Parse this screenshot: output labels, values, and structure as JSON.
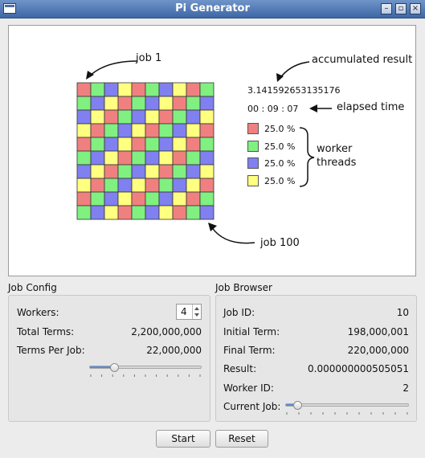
{
  "window": {
    "title": "Pi Generator",
    "controls": {
      "minimize": "–",
      "maximize": "▫",
      "close": "×"
    }
  },
  "visual": {
    "annotations": {
      "job1": "job 1",
      "job100": "job 100",
      "accumulated": "accumulated result",
      "elapsed": "elapsed time",
      "worker_threads_line1": "worker",
      "worker_threads_line2": "threads"
    },
    "result_value": "3.141592653135176",
    "elapsed_time": "00 : 09 : 07",
    "workers_legend": [
      {
        "color": "#f08080",
        "percent": "25.0 %"
      },
      {
        "color": "#80f080",
        "percent": "25.0 %"
      },
      {
        "color": "#8080f0",
        "percent": "25.0 %"
      },
      {
        "color": "#ffff80",
        "percent": "25.0 %"
      }
    ],
    "grid": {
      "rows": 10,
      "cols": 10,
      "colors": [
        "#f08080",
        "#80f080",
        "#8080f0",
        "#ffff80"
      ]
    }
  },
  "job_config": {
    "title": "Job Config",
    "workers_label": "Workers:",
    "workers_value": "4",
    "total_terms_label": "Total Terms:",
    "total_terms_value": "2,200,000,000",
    "terms_per_job_label": "Terms Per Job:",
    "terms_per_job_value": "22,000,000",
    "slider_fraction": 0.22
  },
  "job_browser": {
    "title": "Job Browser",
    "job_id_label": "Job ID:",
    "job_id_value": "10",
    "initial_term_label": "Initial Term:",
    "initial_term_value": "198,000,001",
    "final_term_label": "Final Term:",
    "final_term_value": "220,000,000",
    "result_label": "Result:",
    "result_value": "0.000000000505051",
    "worker_id_label": "Worker ID:",
    "worker_id_value": "2",
    "current_job_label": "Current Job:",
    "current_job_fraction": 0.1
  },
  "buttons": {
    "start": "Start",
    "reset": "Reset"
  }
}
